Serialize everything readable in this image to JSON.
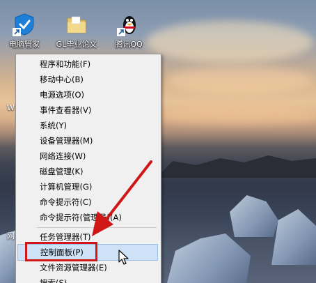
{
  "desktop": {
    "icons": [
      {
        "label": "电脑管家",
        "icon": "tencent-pc-manager-icon"
      },
      {
        "label": "GL毕业论文",
        "icon": "folder-icon"
      },
      {
        "label": "腾讯QQ",
        "icon": "qq-penguin-icon"
      }
    ],
    "partial_labels": [
      "W",
      "网"
    ]
  },
  "context_menu": {
    "items": [
      {
        "label": "程序和功能(F)"
      },
      {
        "label": "移动中心(B)"
      },
      {
        "label": "电源选项(O)"
      },
      {
        "label": "事件查看器(V)"
      },
      {
        "label": "系统(Y)"
      },
      {
        "label": "设备管理器(M)"
      },
      {
        "label": "网络连接(W)"
      },
      {
        "label": "磁盘管理(K)"
      },
      {
        "label": "计算机管理(G)"
      },
      {
        "label": "命令提示符(C)"
      },
      {
        "label": "命令提示符(管理员)(A)"
      },
      {
        "label": "任务管理器(T)"
      },
      {
        "label": "控制面板(P)",
        "highlighted": true
      },
      {
        "label": "文件资源管理器(E)"
      },
      {
        "label": "搜索(S)"
      }
    ]
  },
  "annotation": {
    "color": "#d01616"
  },
  "colors": {
    "menu_bg": "#f0f0f0",
    "highlight": "#cde2f7",
    "highlight_border": "#99c1e8"
  }
}
